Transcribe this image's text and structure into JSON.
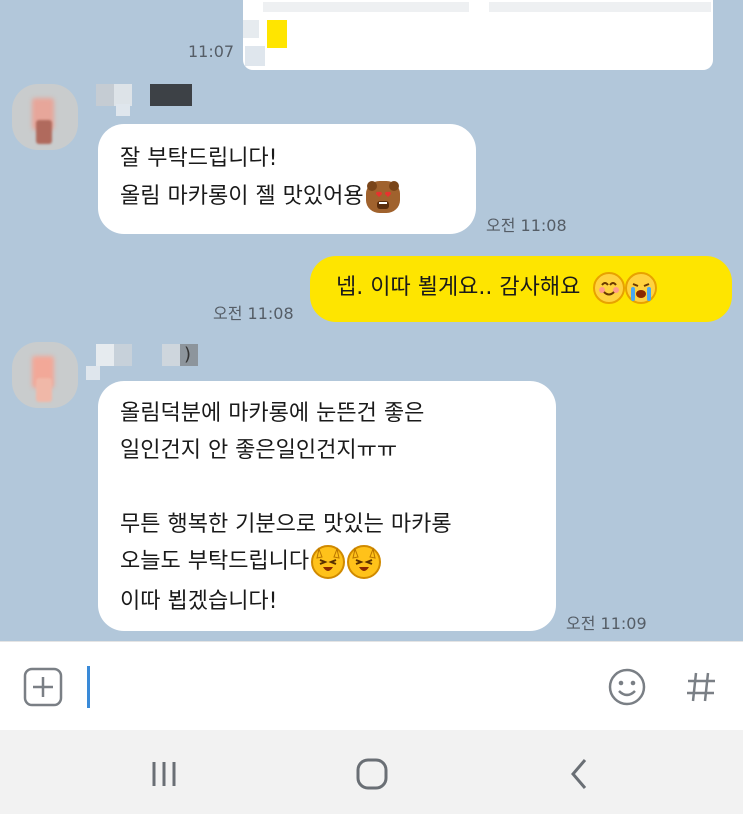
{
  "messages": [
    {
      "id": "m0",
      "side": "out",
      "time": "11:07"
    },
    {
      "id": "m1",
      "side": "in",
      "lines": [
        "잘 부탁드립니다!",
        "올림 마카롱이 젤 맛있어용"
      ],
      "emoji": [
        "heart-eyes-bear"
      ],
      "time": "오전 11:08"
    },
    {
      "id": "m2",
      "side": "out",
      "text": "넵. 이따 뵐게요.. 감사해요",
      "emoji": [
        "smiling-face",
        "crying-face"
      ],
      "time": "오전 11:08"
    },
    {
      "id": "m3",
      "side": "in",
      "sender_suffix": ")",
      "lines": [
        "올림덕분에 마카롱에 눈뜬건 좋은",
        "일인건지 안 좋은일인건지ㅠㅠ",
        "",
        "무튼 행복한 기분으로 맛있는 마카롱",
        "오늘도 부탁드립니다",
        "이따 뵙겠습니다!"
      ],
      "emoji": [
        "laughing-cat",
        "laughing-cat"
      ],
      "time": "오전 11:09"
    }
  ],
  "input": {
    "placeholder": "",
    "value": ""
  },
  "icons": {
    "attach": "plus-square-icon",
    "emoticon": "smiley-icon",
    "hashtag": "hash-icon",
    "nav_recent": "recent-apps-icon",
    "nav_home": "home-icon",
    "nav_back": "back-icon"
  },
  "colors": {
    "chat_background": "#b2c7da",
    "outgoing_bubble": "#fee500",
    "incoming_bubble": "#ffffff",
    "cursor": "#3a8ad8"
  }
}
